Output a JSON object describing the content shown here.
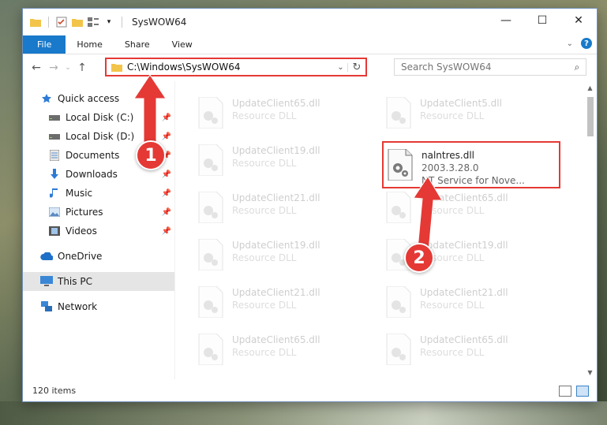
{
  "window": {
    "title": "SysWOW64"
  },
  "ribbon": {
    "tabs": [
      "File",
      "Home",
      "Share",
      "View"
    ]
  },
  "nav": {
    "address": "C:\\Windows\\SysWOW64",
    "search_placeholder": "Search SysWOW64"
  },
  "sidebar": {
    "items": [
      {
        "label": "Quick access",
        "icon": "star-icon"
      },
      {
        "label": "Local Disk (C:)",
        "icon": "drive-icon"
      },
      {
        "label": "Local Disk (D:)",
        "icon": "drive-icon"
      },
      {
        "label": "Documents",
        "icon": "documents-icon"
      },
      {
        "label": "Downloads",
        "icon": "download-icon"
      },
      {
        "label": "Music",
        "icon": "music-icon"
      },
      {
        "label": "Pictures",
        "icon": "pictures-icon"
      },
      {
        "label": "Videos",
        "icon": "videos-icon"
      },
      {
        "label": "OneDrive",
        "icon": "cloud-icon"
      },
      {
        "label": "This PC",
        "icon": "pc-icon"
      },
      {
        "label": "Network",
        "icon": "network-icon"
      }
    ]
  },
  "files": {
    "left_column": [
      {
        "name": "UpdateClient65.dll",
        "sub": "Resource DLL"
      },
      {
        "name": "UpdateClient19.dll",
        "sub": "Resource DLL"
      },
      {
        "name": "UpdateClient21.dll",
        "sub": "Resource DLL"
      },
      {
        "name": "UpdateClient19.dll",
        "sub": "Resource DLL"
      },
      {
        "name": "UpdateClient21.dll",
        "sub": "Resource DLL"
      },
      {
        "name": "UpdateClient65.dll",
        "sub": "Resource DLL"
      }
    ],
    "right_column": [
      {
        "name": "UpdateClient5.dll",
        "sub": "Resource DLL"
      },
      {
        "name": "UpdateClient65.dll",
        "sub": "Resource DLL"
      },
      {
        "name": "UpdateClient19.dll",
        "sub": "Resource DLL"
      },
      {
        "name": "UpdateClient21.dll",
        "sub": "Resource DLL"
      },
      {
        "name": "UpdateClient65.dll",
        "sub": "Resource DLL"
      }
    ],
    "highlighted": {
      "name": "nalntres.dll",
      "version": "2003.3.28.0",
      "description": "NT Service for Nove..."
    }
  },
  "status": {
    "count": "120 items"
  },
  "annotations": {
    "step1": "1",
    "step2": "2",
    "color": "#e53935"
  }
}
